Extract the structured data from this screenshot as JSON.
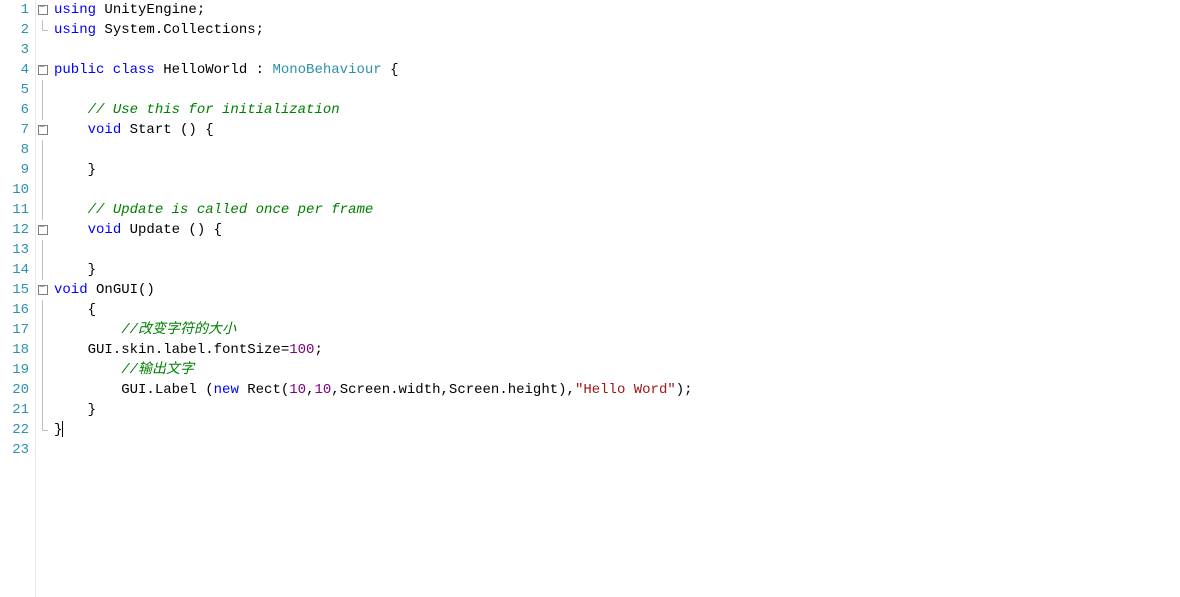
{
  "editor": {
    "line_count": 23,
    "fold_markers": {
      "1": "box",
      "2": "end",
      "4": "box",
      "5": "line",
      "6": "line",
      "7": "box",
      "8": "line",
      "9": "line",
      "10": "line",
      "11": "line",
      "12": "box",
      "13": "line",
      "14": "line",
      "15": "box",
      "16": "line",
      "17": "line",
      "18": "line",
      "19": "line",
      "20": "line",
      "21": "line",
      "22": "end"
    },
    "lines": {
      "1": [
        {
          "t": "using ",
          "c": "kw"
        },
        {
          "t": "UnityEngine",
          "c": "pln"
        },
        {
          "t": ";",
          "c": "pln"
        }
      ],
      "2": [
        {
          "t": "using ",
          "c": "kw"
        },
        {
          "t": "System.Collections",
          "c": "pln"
        },
        {
          "t": ";",
          "c": "pln"
        }
      ],
      "3": [],
      "4": [
        {
          "t": "public class ",
          "c": "kw"
        },
        {
          "t": "HelloWorld",
          "c": "pln"
        },
        {
          "t": " : ",
          "c": "pln"
        },
        {
          "t": "MonoBehaviour",
          "c": "type"
        },
        {
          "t": " {",
          "c": "pln"
        }
      ],
      "5": [],
      "6": [
        {
          "t": "    ",
          "c": "pln"
        },
        {
          "t": "// Use this for initialization",
          "c": "comment"
        }
      ],
      "7": [
        {
          "t": "    ",
          "c": "pln"
        },
        {
          "t": "void ",
          "c": "kw"
        },
        {
          "t": "Start () {",
          "c": "pln"
        }
      ],
      "8": [
        {
          "t": "    ",
          "c": "pln"
        }
      ],
      "9": [
        {
          "t": "    }",
          "c": "pln"
        }
      ],
      "10": [
        {
          "t": "    ",
          "c": "pln"
        }
      ],
      "11": [
        {
          "t": "    ",
          "c": "pln"
        },
        {
          "t": "// Update is called once per frame",
          "c": "comment"
        }
      ],
      "12": [
        {
          "t": "    ",
          "c": "pln"
        },
        {
          "t": "void ",
          "c": "kw"
        },
        {
          "t": "Update () {",
          "c": "pln"
        }
      ],
      "13": [
        {
          "t": "    ",
          "c": "pln"
        }
      ],
      "14": [
        {
          "t": "    }",
          "c": "pln"
        }
      ],
      "15": [
        {
          "t": "void ",
          "c": "kw"
        },
        {
          "t": "OnGUI()",
          "c": "pln"
        }
      ],
      "16": [
        {
          "t": "    {",
          "c": "pln"
        }
      ],
      "17": [
        {
          "t": "        ",
          "c": "pln"
        },
        {
          "t": "//改变字符的大小",
          "c": "comment"
        }
      ],
      "18": [
        {
          "t": "    GUI.skin.label.fontSize=",
          "c": "pln"
        },
        {
          "t": "100",
          "c": "num"
        },
        {
          "t": ";",
          "c": "pln"
        }
      ],
      "19": [
        {
          "t": "        ",
          "c": "pln"
        },
        {
          "t": "//输出文字",
          "c": "comment"
        }
      ],
      "20": [
        {
          "t": "        GUI.Label (",
          "c": "pln"
        },
        {
          "t": "new ",
          "c": "kw"
        },
        {
          "t": "Rect(",
          "c": "pln"
        },
        {
          "t": "10",
          "c": "num"
        },
        {
          "t": ",",
          "c": "pln"
        },
        {
          "t": "10",
          "c": "num"
        },
        {
          "t": ",Screen.width,Screen.height),",
          "c": "pln"
        },
        {
          "t": "\"Hello Word\"",
          "c": "str"
        },
        {
          "t": ");",
          "c": "pln"
        }
      ],
      "21": [
        {
          "t": "    }",
          "c": "pln"
        }
      ],
      "22": [
        {
          "t": "}",
          "c": "pln"
        }
      ],
      "23": []
    },
    "caret_line": 22
  }
}
